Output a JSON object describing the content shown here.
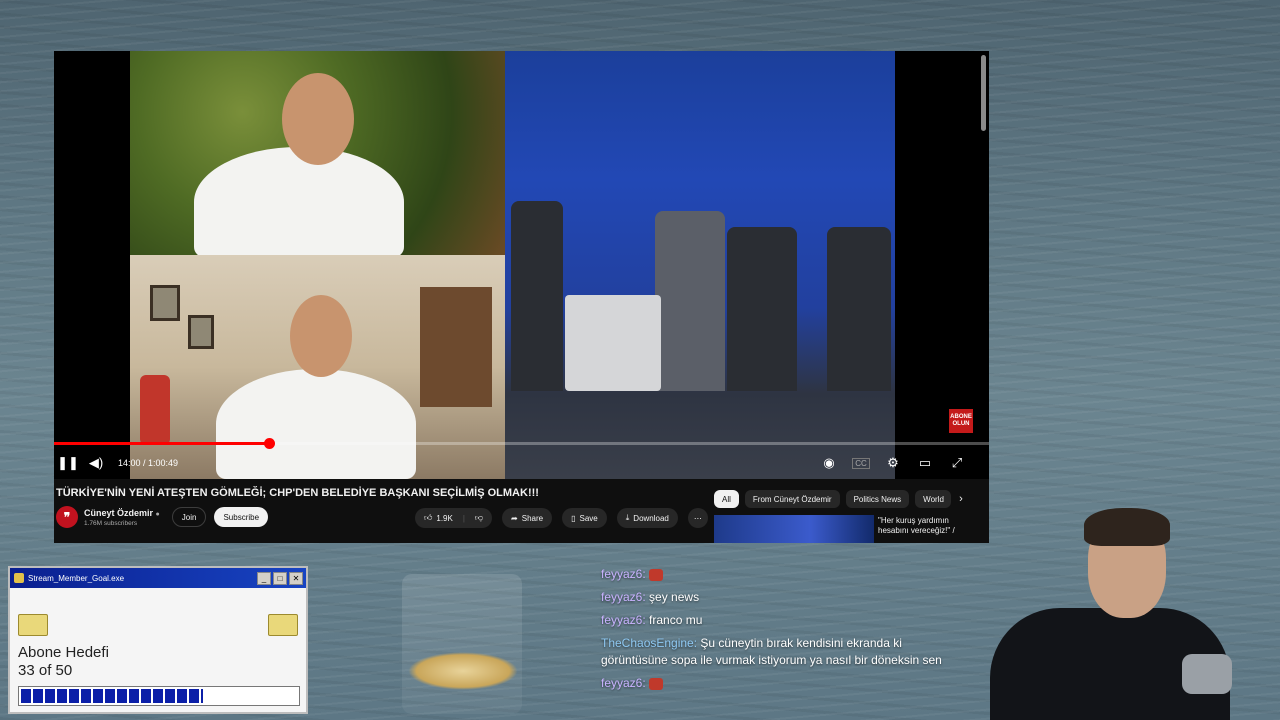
{
  "video": {
    "title": "TÜRKİYE'NİN YENİ ATEŞTEN GÖMLEĞİ; CHP'DEN BELEDİYE BAŞKANI SEÇİLMİŞ OLMAK!!!",
    "time_display": "14:00 / 1:00:49",
    "progress_fraction": 0.2302,
    "abone_badge": "ABONE OLUN",
    "channel": {
      "name": "Cüneyt Özdemir",
      "subscribers": "1.76M subscribers",
      "join_label": "Join",
      "subscribe_label": "Subscribe"
    },
    "actions": {
      "like_count": "1.9K",
      "share_label": "Share",
      "save_label": "Save",
      "download_label": "Download"
    },
    "chips": [
      "All",
      "From Cüneyt Özdemir",
      "Politics News",
      "World"
    ],
    "recommended": {
      "title": "\"Her kuruş yardımın hesabını vereceğiz!\" /"
    }
  },
  "goal_window": {
    "title": "Stream_Member_Goal.exe",
    "label": "Abone Hedefi",
    "count_text": "33 of 50",
    "progress_fraction": 0.66
  },
  "chat": [
    {
      "user": "feyyaz6:",
      "text": "",
      "emote": true,
      "user_color": "#c9b3ff"
    },
    {
      "user": "feyyaz6:",
      "text": "şey news",
      "emote": false,
      "user_color": "#c9b3ff"
    },
    {
      "user": "feyyaz6:",
      "text": "franco mu",
      "emote": false,
      "user_color": "#c9b3ff"
    },
    {
      "user": "TheChaosEngine:",
      "text": "Şu cüneytin bırak kendisini ekranda ki görüntüsüne sopa ile vurmak istiyorum ya nasıl bir döneksin sen",
      "emote": false,
      "user_color": "#8ec8f2"
    },
    {
      "user": "feyyaz6:",
      "text": "",
      "emote": true,
      "user_color": "#c9b3ff"
    }
  ]
}
